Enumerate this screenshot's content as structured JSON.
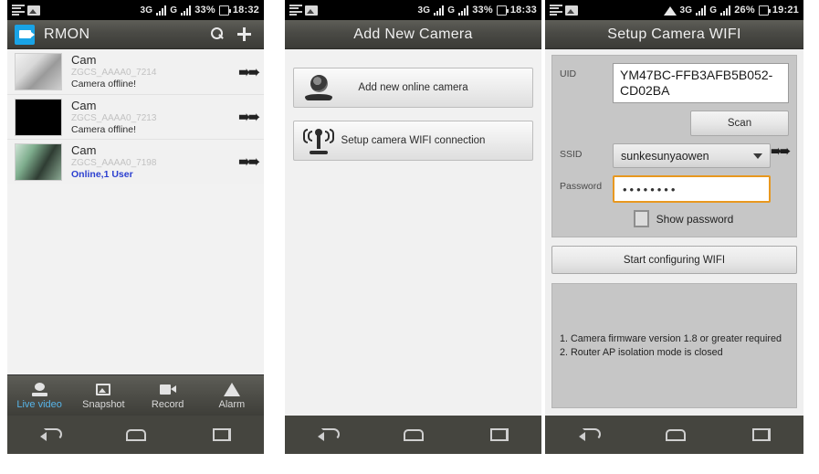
{
  "phone1": {
    "status_bar": {
      "battery": "33%",
      "time": "18:32",
      "network_labels": [
        "3G",
        "G"
      ]
    },
    "title": "RMON",
    "actions": {
      "search": "search",
      "add": "add"
    },
    "cameras": [
      {
        "name": "Cam",
        "uid": "ZGCS_AAAA0_7214",
        "status": "Camera offline!",
        "online": false
      },
      {
        "name": "Cam",
        "uid": "ZGCS_AAAA0_7213",
        "status": "Camera offline!",
        "online": false
      },
      {
        "name": "Cam",
        "uid": "ZGCS_AAAA0_7198",
        "status": "Online,1 User",
        "online": true
      }
    ],
    "tabs": [
      {
        "label": "Live video",
        "active": true
      },
      {
        "label": "Snapshot",
        "active": false
      },
      {
        "label": "Record",
        "active": false
      },
      {
        "label": "Alarm",
        "active": false
      }
    ],
    "accent_active": "#57b4e8",
    "online_color": "#2b3fd0"
  },
  "phone2": {
    "status_bar": {
      "battery": "33%",
      "time": "18:33",
      "network_labels": [
        "3G",
        "G"
      ]
    },
    "title": "Add New Camera",
    "buttons": [
      {
        "label": "Add new online camera"
      },
      {
        "label": "Setup camera WIFI connection"
      }
    ]
  },
  "phone3": {
    "status_bar": {
      "battery": "26%",
      "time": "19:21",
      "network_labels": [
        "3G",
        "G"
      ]
    },
    "title": "Setup Camera WIFI",
    "fields": {
      "uid_label": "UID",
      "uid_value": "YM47BC-FFB3AFB5B052-CD02BA",
      "scan_label": "Scan",
      "ssid_label": "SSID",
      "ssid_value": "sunkesunyaowen",
      "password_label": "Password",
      "password_value": "••••••••",
      "show_password_label": "Show password",
      "show_password_checked": false
    },
    "start_button": "Start configuring WIFI",
    "notes": [
      "1. Camera firmware version 1.8 or greater required",
      "2. Router AP isolation mode is closed"
    ],
    "focus_color": "#e8981f"
  }
}
